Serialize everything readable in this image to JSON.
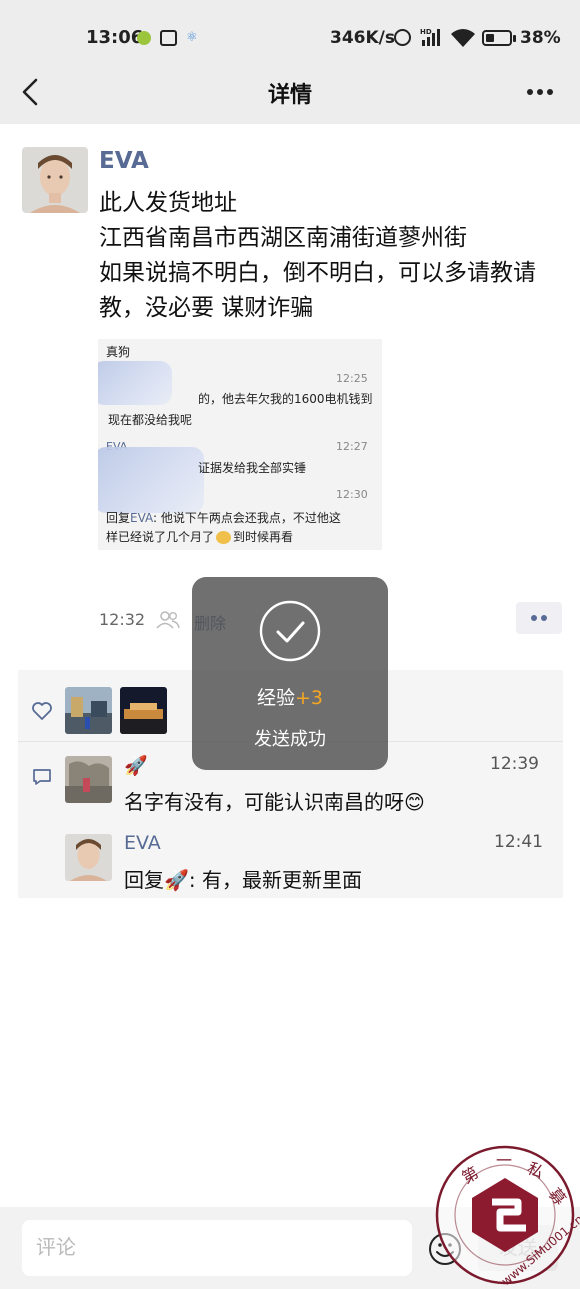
{
  "status_bar": {
    "time": "13:06",
    "network_speed": "346K/s",
    "signal": "HD",
    "battery_percent": "38%",
    "battery_level": 0.38
  },
  "nav": {
    "title": "详情"
  },
  "post": {
    "author": "EVA",
    "lines": [
      "此人发货地址",
      "江西省南昌市西湖区南浦街道蓼州街",
      "如果说搞不明白，倒不明白，可以多请教请",
      "教，没必要 谋财诈骗"
    ],
    "screenshot": {
      "header": "真狗",
      "msg1_time": "12:25",
      "msg1_line1": "的，他去年欠我的1600电机钱到",
      "msg1_line2": "现在都没给我呢",
      "msg2_name": "EVA",
      "msg2_time": "12:27",
      "msg2_text": "证据发给我全部实锤",
      "msg3_time": "12:30",
      "msg3_prefix": "回复",
      "msg3_name": "EVA",
      "msg3_line1": ": 他说下午两点会还我点，不过他这",
      "msg3_line2": "样已经说了几个月了",
      "msg3_tail": "到时候再看"
    },
    "time": "12:32",
    "delete_label": "删除"
  },
  "comments": [
    {
      "author": "🚀",
      "time": "12:39",
      "text": "名字有没有，可能认识南昌的呀😊"
    },
    {
      "author": "EVA",
      "time": "12:41",
      "text": "回复🚀: 有，最新更新里面"
    }
  ],
  "toast": {
    "xp_label": "经验",
    "xp_value": "+3",
    "message": "发送成功"
  },
  "bottom_bar": {
    "placeholder": "评论",
    "send_label": "发送"
  },
  "watermark": {
    "text": "第一私募 www.SiMu001.cn"
  },
  "colors": {
    "link": "#576b95",
    "accent_orange": "#f5a623",
    "header_bg": "#ededed"
  }
}
